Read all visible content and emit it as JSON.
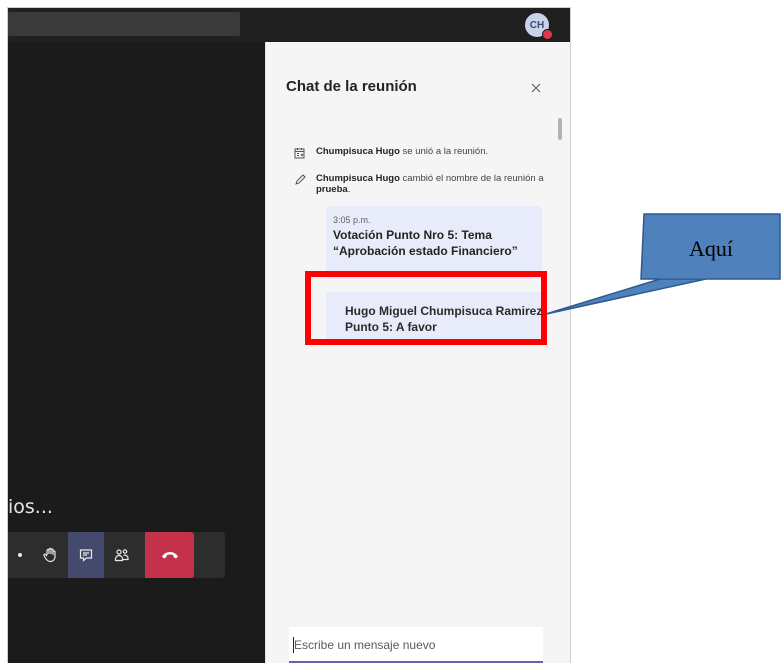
{
  "top_bar": {
    "avatar_initials": "CH"
  },
  "meeting": {
    "caption": "ios...",
    "controls": [
      {
        "name": "more-options",
        "icon": "dots-icon"
      },
      {
        "name": "raise-hand",
        "icon": "hand-icon"
      },
      {
        "name": "chat",
        "icon": "chat-icon",
        "active": true
      },
      {
        "name": "participants",
        "icon": "people-icon"
      },
      {
        "name": "leave",
        "icon": "hang-up-icon"
      }
    ]
  },
  "chat_panel": {
    "title": "Chat de la reunión",
    "close_icon": "close-icon",
    "events": [
      {
        "icon": "calendar-icon",
        "name": "Chumpisuca Hugo",
        "text": " se unió a la reunión."
      },
      {
        "icon": "pencil-icon",
        "name": "Chumpisuca Hugo",
        "text": " cambió el nombre de la reunión a ",
        "highlight": "prueba",
        "suffix": "."
      }
    ],
    "messages": [
      {
        "time": "3:05 p.m.",
        "text": "Votación Punto Nro 5: Tema “Aprobación estado Financiero”"
      },
      {
        "time": "",
        "text": "Hugo Miguel Chumpisuca Ramirez: Punto 5: A favor"
      }
    ],
    "input": {
      "placeholder": "Escribe un mensaje nuevo",
      "value": ""
    }
  },
  "annotation": {
    "callout_label": "Aquí",
    "highlight_color": "#ff0000",
    "callout_color": "#4f81bd"
  },
  "colors": {
    "accent": "#6264a7",
    "leave": "#c4314b",
    "message_bg": "#e8ebfa"
  }
}
